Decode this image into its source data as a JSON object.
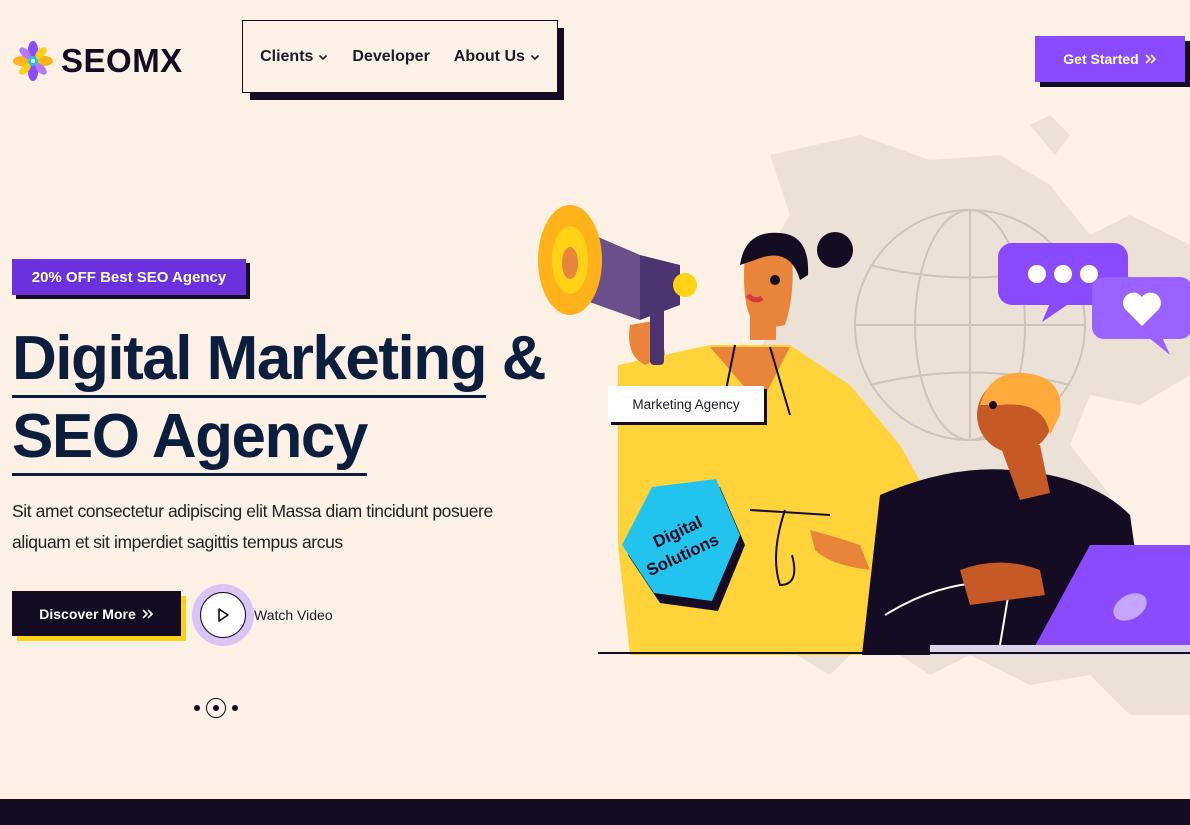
{
  "brand": {
    "name": "SEOMX"
  },
  "nav": {
    "items": [
      {
        "label": "Clients",
        "has_dropdown": true
      },
      {
        "label": "Developer",
        "has_dropdown": false
      },
      {
        "label": "About Us",
        "has_dropdown": true
      }
    ]
  },
  "header": {
    "cta_label": "Get Started"
  },
  "hero": {
    "badge": "20% OFF Best SEO Agency",
    "headline_line1": "Digital Marketing",
    "headline_amp": "&",
    "headline_line2": "SEO Agency",
    "subtext": "Sit amet consectetur adipiscing elit Massa diam tincidunt posuere aliquam et sit imperdiet sagittis tempus arcus",
    "primary_button": "Discover More",
    "video_label": "Watch Video",
    "illustration_tag": "Marketing Agency",
    "sign_line1": "Digital",
    "sign_line2": "Solutions"
  },
  "slider": {
    "count": 3,
    "active": 2
  },
  "colors": {
    "background": "#fdf1e6",
    "dark": "#130c22",
    "accent_purple": "#8a4bff",
    "badge_purple": "#6a31dc",
    "accent_yellow": "#ffd215",
    "sign_cyan": "#22c4ee"
  }
}
